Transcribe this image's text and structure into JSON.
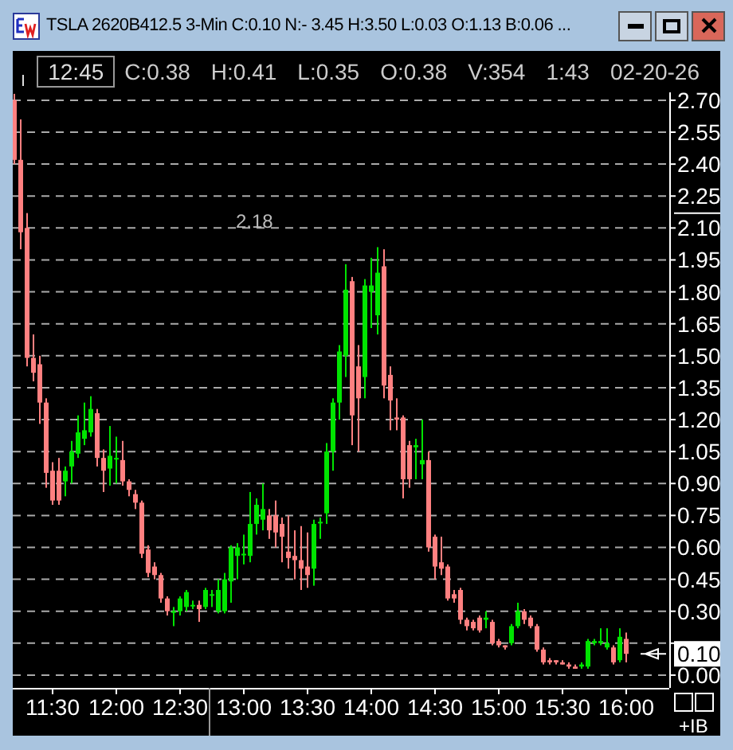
{
  "window": {
    "title": "TSLA 2620B412.5 3-Min C:0.10 N:- 3.45 H:3.50 L:0.03 O:1.13 B:0.06 ..."
  },
  "cursor_bar": {
    "time": "12:45",
    "fields": [
      "C:0.38",
      "H:0.41",
      "L:0.35",
      "O:0.38",
      "V:354",
      "1:43",
      "02-20-26"
    ]
  },
  "chart": {
    "chart_data": {
      "type": "candlestick",
      "grid": true,
      "xlim": [
        11.1875,
        16.3375
      ],
      "ylim": [
        -0.06,
        2.737
      ],
      "xticks": [
        {
          "value": 11.5,
          "label": "11:30"
        },
        {
          "value": 12,
          "label": "12:00"
        },
        {
          "value": 12.5,
          "label": "12:30"
        },
        {
          "value": 13,
          "label": "13:00"
        },
        {
          "value": 13.5,
          "label": "13:30"
        },
        {
          "value": 14,
          "label": "14:00"
        },
        {
          "value": 14.5,
          "label": "14:30"
        },
        {
          "value": 15,
          "label": "15:00"
        },
        {
          "value": 15.5,
          "label": "15:30"
        },
        {
          "value": 16,
          "label": "16:00"
        }
      ],
      "yticks": [
        {
          "value": 0,
          "label": "0.00"
        },
        {
          "value": 0.3,
          "label": "0.30"
        },
        {
          "value": 0.45,
          "label": "0.45"
        },
        {
          "value": 0.6,
          "label": "0.60"
        },
        {
          "value": 0.75,
          "label": "0.75"
        },
        {
          "value": 0.9,
          "label": "0.90"
        },
        {
          "value": 1.05,
          "label": "1.05"
        },
        {
          "value": 1.2,
          "label": "1.20"
        },
        {
          "value": 1.35,
          "label": "1.35"
        },
        {
          "value": 1.5,
          "label": "1.50"
        },
        {
          "value": 1.65,
          "label": "1.65"
        },
        {
          "value": 1.8,
          "label": "1.80"
        },
        {
          "value": 1.95,
          "label": "1.95"
        },
        {
          "value": 2.1,
          "label": "2.10"
        },
        {
          "value": 2.25,
          "label": "2.25"
        },
        {
          "value": 2.4,
          "label": "2.40"
        },
        {
          "value": 2.55,
          "label": "2.55"
        },
        {
          "value": 2.7,
          "label": "2.70"
        }
      ],
      "x": [
        11.2,
        11.25,
        11.3,
        11.35,
        11.4,
        11.45,
        11.5,
        11.55,
        11.6,
        11.65,
        11.7,
        11.75,
        11.8,
        11.85,
        11.9,
        11.95,
        12,
        12.05,
        12.1,
        12.15,
        12.2,
        12.25,
        12.3,
        12.35,
        12.4,
        12.45,
        12.5,
        12.55,
        12.6,
        12.65,
        12.7,
        12.75,
        12.8,
        12.85,
        12.9,
        12.95,
        13,
        13.05,
        13.1,
        13.15,
        13.2,
        13.25,
        13.3,
        13.35,
        13.4,
        13.45,
        13.5,
        13.55,
        13.6,
        13.65,
        13.7,
        13.75,
        13.8,
        13.85,
        13.9,
        13.95,
        14,
        14.05,
        14.1,
        14.15,
        14.2,
        14.25,
        14.3,
        14.35,
        14.4,
        14.45,
        14.5,
        14.55,
        14.6,
        14.65,
        14.7,
        14.75,
        14.8,
        14.85,
        14.9,
        14.95,
        15,
        15.05,
        15.1,
        15.15,
        15.2,
        15.25,
        15.3,
        15.35,
        15.4,
        15.45,
        15.5,
        15.55,
        15.6,
        15.65,
        15.7,
        15.75,
        15.8,
        15.85,
        15.9,
        15.95,
        16
      ],
      "ohlc": [
        [
          2.7,
          2.73,
          2.4,
          2.42
        ],
        [
          2.42,
          2.61,
          2.0,
          2.08
        ],
        [
          2.1,
          2.17,
          1.45,
          1.49
        ],
        [
          1.49,
          1.6,
          1.38,
          1.42
        ],
        [
          1.46,
          1.5,
          1.18,
          1.28
        ],
        [
          1.28,
          1.3,
          0.88,
          0.95
        ],
        [
          0.96,
          1.0,
          0.8,
          0.82
        ],
        [
          0.96,
          1.02,
          0.8,
          0.82
        ],
        [
          0.91,
          0.98,
          0.84,
          0.96
        ],
        [
          0.98,
          1.1,
          0.9,
          1.05
        ],
        [
          1.04,
          1.22,
          1.02,
          1.14
        ],
        [
          1.11,
          1.28,
          1.08,
          1.15
        ],
        [
          1.14,
          1.31,
          1.12,
          1.25
        ],
        [
          1.23,
          1.25,
          0.98,
          1.02
        ],
        [
          1.02,
          1.06,
          0.86,
          0.96
        ],
        [
          0.97,
          1.17,
          0.89,
          1.03
        ],
        [
          1.02,
          1.12,
          0.9,
          1.02
        ],
        [
          1.01,
          1.1,
          0.89,
          0.91
        ],
        [
          0.91,
          0.92,
          0.84,
          0.87
        ],
        [
          0.85,
          0.87,
          0.78,
          0.81
        ],
        [
          0.81,
          0.82,
          0.55,
          0.57
        ],
        [
          0.59,
          0.61,
          0.46,
          0.48
        ],
        [
          0.51,
          0.53,
          0.45,
          0.47
        ],
        [
          0.47,
          0.48,
          0.34,
          0.36
        ],
        [
          0.36,
          0.37,
          0.28,
          0.3
        ],
        [
          0.3,
          0.32,
          0.23,
          0.3
        ],
        [
          0.3,
          0.37,
          0.28,
          0.36
        ],
        [
          0.32,
          0.4,
          0.3,
          0.39
        ],
        [
          0.33,
          0.35,
          0.31,
          0.33
        ],
        [
          0.33,
          0.35,
          0.25,
          0.31
        ],
        [
          0.32,
          0.41,
          0.31,
          0.4
        ],
        [
          0.38,
          0.4,
          0.32,
          0.38
        ],
        [
          0.3,
          0.45,
          0.29,
          0.4
        ],
        [
          0.3,
          0.48,
          0.29,
          0.45
        ],
        [
          0.44,
          0.61,
          0.34,
          0.6
        ],
        [
          0.56,
          0.62,
          0.45,
          0.6
        ],
        [
          0.57,
          0.66,
          0.52,
          0.57
        ],
        [
          0.56,
          0.86,
          0.53,
          0.71
        ],
        [
          0.71,
          0.83,
          0.66,
          0.8
        ],
        [
          0.73,
          0.9,
          0.68,
          0.78
        ],
        [
          0.75,
          0.78,
          0.64,
          0.68
        ],
        [
          0.75,
          0.82,
          0.6,
          0.67
        ],
        [
          0.71,
          0.74,
          0.53,
          0.65
        ],
        [
          0.58,
          0.75,
          0.5,
          0.55
        ],
        [
          0.56,
          0.68,
          0.45,
          0.54
        ],
        [
          0.54,
          0.7,
          0.4,
          0.5
        ],
        [
          0.51,
          0.67,
          0.41,
          0.47
        ],
        [
          0.5,
          0.73,
          0.42,
          0.71
        ],
        [
          0.72,
          0.74,
          0.64,
          0.72
        ],
        [
          0.76,
          1.09,
          0.71,
          1.05
        ],
        [
          1.05,
          1.3,
          0.96,
          1.28
        ],
        [
          1.28,
          1.55,
          1.2,
          1.52
        ],
        [
          1.5,
          1.93,
          1.4,
          1.81
        ],
        [
          1.85,
          1.87,
          1.08,
          1.22
        ],
        [
          1.45,
          1.55,
          1.05,
          1.3
        ],
        [
          1.4,
          1.86,
          1.3,
          1.83
        ],
        [
          1.8,
          1.96,
          1.63,
          1.83
        ],
        [
          1.69,
          2.01,
          1.6,
          1.89
        ],
        [
          1.92,
          2.0,
          1.3,
          1.36
        ],
        [
          1.41,
          1.45,
          1.15,
          1.29
        ],
        [
          1.21,
          1.3,
          1.15,
          1.2
        ],
        [
          1.21,
          1.22,
          0.83,
          0.92
        ],
        [
          1.08,
          1.1,
          0.88,
          0.92
        ],
        [
          1.07,
          1.11,
          0.92,
          1.08
        ],
        [
          0.99,
          1.2,
          0.92,
          1.01
        ],
        [
          1.01,
          1.05,
          0.58,
          0.6
        ],
        [
          0.65,
          0.66,
          0.45,
          0.51
        ],
        [
          0.53,
          0.65,
          0.47,
          0.5
        ],
        [
          0.51,
          0.52,
          0.35,
          0.36
        ],
        [
          0.38,
          0.4,
          0.34,
          0.36
        ],
        [
          0.4,
          0.41,
          0.24,
          0.26
        ],
        [
          0.26,
          0.27,
          0.21,
          0.23
        ],
        [
          0.25,
          0.26,
          0.21,
          0.22
        ],
        [
          0.27,
          0.28,
          0.2,
          0.21
        ],
        [
          0.26,
          0.3,
          0.22,
          0.27
        ],
        [
          0.25,
          0.26,
          0.14,
          0.15
        ],
        [
          0.16,
          0.17,
          0.13,
          0.14
        ],
        [
          0.14,
          0.14,
          0.12,
          0.13
        ],
        [
          0.15,
          0.24,
          0.14,
          0.23
        ],
        [
          0.23,
          0.34,
          0.22,
          0.3
        ],
        [
          0.3,
          0.31,
          0.24,
          0.26
        ],
        [
          0.27,
          0.28,
          0.22,
          0.23
        ],
        [
          0.23,
          0.24,
          0.11,
          0.12
        ],
        [
          0.12,
          0.13,
          0.05,
          0.06
        ],
        [
          0.07,
          0.08,
          0.05,
          0.06
        ],
        [
          0.07,
          0.07,
          0.05,
          0.06
        ],
        [
          0.06,
          0.07,
          0.05,
          0.05
        ],
        [
          0.05,
          0.06,
          0.03,
          0.04
        ],
        [
          0.04,
          0.05,
          0.03,
          0.03
        ],
        [
          0.04,
          0.06,
          0.03,
          0.05
        ],
        [
          0.04,
          0.17,
          0.03,
          0.16
        ],
        [
          0.15,
          0.17,
          0.14,
          0.16
        ],
        [
          0.15,
          0.22,
          0.14,
          0.16
        ],
        [
          0.13,
          0.22,
          0.12,
          0.15
        ],
        [
          0.13,
          0.14,
          0.05,
          0.06
        ],
        [
          0.07,
          0.22,
          0.06,
          0.18
        ],
        [
          0.17,
          0.2,
          0.06,
          0.1
        ]
      ],
      "annotations": [
        "2.18"
      ]
    },
    "last_price": "0.10"
  },
  "footer": {
    "label": "+IB"
  }
}
